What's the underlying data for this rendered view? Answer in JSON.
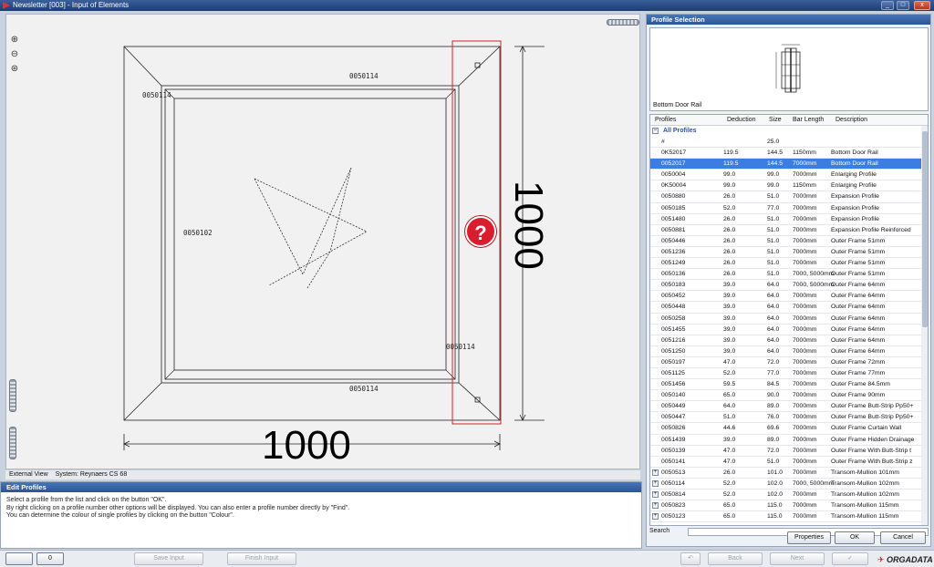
{
  "window": {
    "title": "Newsletter [003] - Input of Elements",
    "min_glyph": "_",
    "max_glyph": "□",
    "close_glyph": "x"
  },
  "canvas": {
    "profile_top": "0050114",
    "profile_left_top": "0050114",
    "profile_bottom": "0050114",
    "profile_right": "0050114",
    "profile_center": "0050102",
    "dim_width": "1000",
    "dim_height": "1000",
    "help_glyph": "?"
  },
  "view_status": {
    "view": "External View",
    "system": "System: Reynaers CS 68"
  },
  "edit_profiles": {
    "title": "Edit Profiles",
    "lines": [
      "Select a profile from the list and click on the button \"OK\".",
      "By right clicking on a profile number other options will be displayed. You can also enter a profile number directly by \"Find\".",
      "You can determine the colour of single profiles by clicking on the button \"Colour\"."
    ]
  },
  "profile_selection": {
    "title": "Profile Selection",
    "preview_label": "Bottom Door Rail",
    "columns": [
      "Profiles",
      "Deduction",
      "Size",
      "Bar Length",
      "Description"
    ],
    "group": "All Profiles",
    "rows": [
      [
        "#",
        "",
        "25.0",
        "",
        ""
      ],
      [
        "0K52017",
        "119.5",
        "144.5",
        "1150mm",
        "Bottom Door Rail"
      ],
      [
        "0052017",
        "119.5",
        "144.5",
        "7000mm",
        "Bottom Door Rail"
      ],
      [
        "0050004",
        "99.0",
        "99.0",
        "7000mm",
        "Enlarging Profile"
      ],
      [
        "0K50004",
        "99.0",
        "99.0",
        "1150mm",
        "Enlarging Profile"
      ],
      [
        "0050880",
        "26.0",
        "51.0",
        "7000mm",
        "Expansion Profile"
      ],
      [
        "0050185",
        "52.0",
        "77.0",
        "7000mm",
        "Expansion Profile"
      ],
      [
        "0051480",
        "26.0",
        "51.0",
        "7000mm",
        "Expansion Profile"
      ],
      [
        "0050881",
        "26.0",
        "51.0",
        "7000mm",
        "Expansion Profile Reinforced"
      ],
      [
        "0050446",
        "26.0",
        "51.0",
        "7000mm",
        "Outer Frame 51mm"
      ],
      [
        "0051236",
        "26.0",
        "51.0",
        "7000mm",
        "Outer Frame 51mm"
      ],
      [
        "0051249",
        "26.0",
        "51.0",
        "7000mm",
        "Outer Frame 51mm"
      ],
      [
        "0050136",
        "26.0",
        "51.0",
        "7000,  5000mm",
        "Outer Frame 51mm"
      ],
      [
        "0050183",
        "39.0",
        "64.0",
        "7000,  5000mm",
        "Outer Frame 64mm"
      ],
      [
        "0050452",
        "39.0",
        "64.0",
        "7000mm",
        "Outer Frame 64mm"
      ],
      [
        "0050448",
        "39.0",
        "64.0",
        "7000mm",
        "Outer Frame 64mm"
      ],
      [
        "0050258",
        "39.0",
        "64.0",
        "7000mm",
        "Outer Frame 64mm"
      ],
      [
        "0051455",
        "39.0",
        "64.0",
        "7000mm",
        "Outer Frame 64mm"
      ],
      [
        "0051216",
        "39.0",
        "64.0",
        "7000mm",
        "Outer Frame 64mm"
      ],
      [
        "0051250",
        "39.0",
        "64.0",
        "7000mm",
        "Outer Frame 64mm"
      ],
      [
        "0050197",
        "47.0",
        "72.0",
        "7000mm",
        "Outer Frame 72mm"
      ],
      [
        "0051125",
        "52.0",
        "77.0",
        "7000mm",
        "Outer Frame 77mm"
      ],
      [
        "0051456",
        "59.5",
        "84.5",
        "7000mm",
        "Outer Frame 84.5mm"
      ],
      [
        "0050140",
        "65.0",
        "90.0",
        "7000mm",
        "Outer Frame 90mm"
      ],
      [
        "0050449",
        "64.0",
        "89.0",
        "7000mm",
        "Outer Frame Butt-Strip Pp50+"
      ],
      [
        "0050447",
        "51.0",
        "76.0",
        "7000mm",
        "Outer Frame Butt-Strip Pp50+"
      ],
      [
        "0050826",
        "44.6",
        "69.6",
        "7000mm",
        "Outer Frame Curtain Wall"
      ],
      [
        "0051439",
        "39.0",
        "89.0",
        "7000mm",
        "Outer Frame Hidden Drainage"
      ],
      [
        "0050139",
        "47.0",
        "72.0",
        "7000mm",
        "Outer Frame With Butt-Strip t"
      ],
      [
        "0050141",
        "47.0",
        "51.0",
        "7000mm",
        "Outer Frame With Butt-Strip z"
      ],
      [
        "0050513",
        "26.0",
        "101.0",
        "7000mm",
        "Transom-Mullion 101mm"
      ],
      [
        "0050114",
        "52.0",
        "102.0",
        "7000,  5000mm",
        "Transom-Mullion 102mm"
      ],
      [
        "0050814",
        "52.0",
        "102.0",
        "7000mm",
        "Transom-Mullion 102mm"
      ],
      [
        "0050823",
        "65.0",
        "115.0",
        "7000mm",
        "Transom-Mullion 115mm"
      ],
      [
        "0050123",
        "65.0",
        "115.0",
        "7000mm",
        "Transom-Mullion 115mm"
      ]
    ],
    "search_label": "Search",
    "search_value": "",
    "properties_label": "Properties",
    "ok_label": "OK",
    "cancel_label": "Cancel"
  },
  "bottom_bar": {
    "tool1": "",
    "tool2": "0",
    "save_input": "Save Input",
    "finish_input": "Finish Input",
    "undo_glyph": "↶",
    "back": "Back",
    "next": "Next",
    "confirm_glyph": "✓",
    "logo": "ORGADATA"
  }
}
